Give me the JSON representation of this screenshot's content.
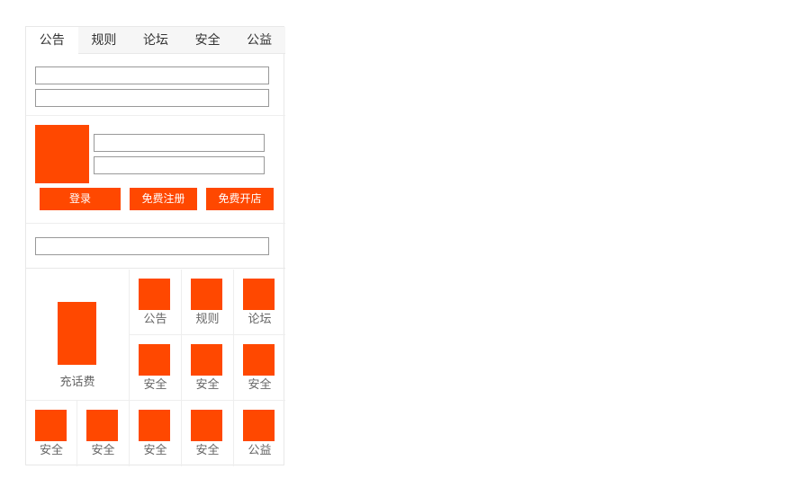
{
  "tabs": [
    "公告",
    "规则",
    "论坛",
    "安全",
    "公益"
  ],
  "active_tab": 0,
  "buttons": {
    "login": "登录",
    "register": "免费注册",
    "open_shop": "免费开店"
  },
  "big_tile": {
    "label": "充话费"
  },
  "grid_top_right": [
    {
      "label": "公告"
    },
    {
      "label": "规则"
    },
    {
      "label": "论坛"
    },
    {
      "label": "安全"
    },
    {
      "label": "安全"
    },
    {
      "label": "安全"
    }
  ],
  "grid_bottom": [
    {
      "label": "安全"
    },
    {
      "label": "安全"
    },
    {
      "label": "安全"
    },
    {
      "label": "安全"
    },
    {
      "label": "公益"
    }
  ],
  "colors": {
    "accent": "#ff4800",
    "tab_bg": "#f6f6f6",
    "border": "#e8e8e8",
    "label_text": "#666666"
  }
}
